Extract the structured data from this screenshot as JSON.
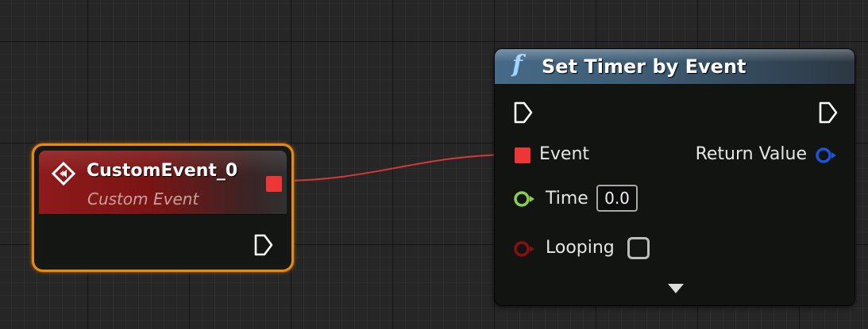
{
  "custom_event_node": {
    "title": "CustomEvent_0",
    "subtitle": "Custom Event",
    "header_color": "#8e1a1a",
    "border_color": "#e58a12",
    "icon": "custom-event-diamond-icon",
    "delegate_pin_color": "#ee3636"
  },
  "function_node": {
    "icon_glyph": "f",
    "title": "Set Timer by Event",
    "header_color": "#466a87",
    "pins": {
      "event_label": "Event",
      "return_label": "Return Value",
      "time_label": "Time",
      "time_value": "0.0",
      "looping_label": "Looping",
      "looping_checked": false
    },
    "pin_colors": {
      "exec": "#ffffff",
      "delegate": "#ee3636",
      "float": "#8ad04a",
      "bool": "#8a1010",
      "struct": "#1c55d8"
    }
  },
  "wire_color": "#d23a3a"
}
